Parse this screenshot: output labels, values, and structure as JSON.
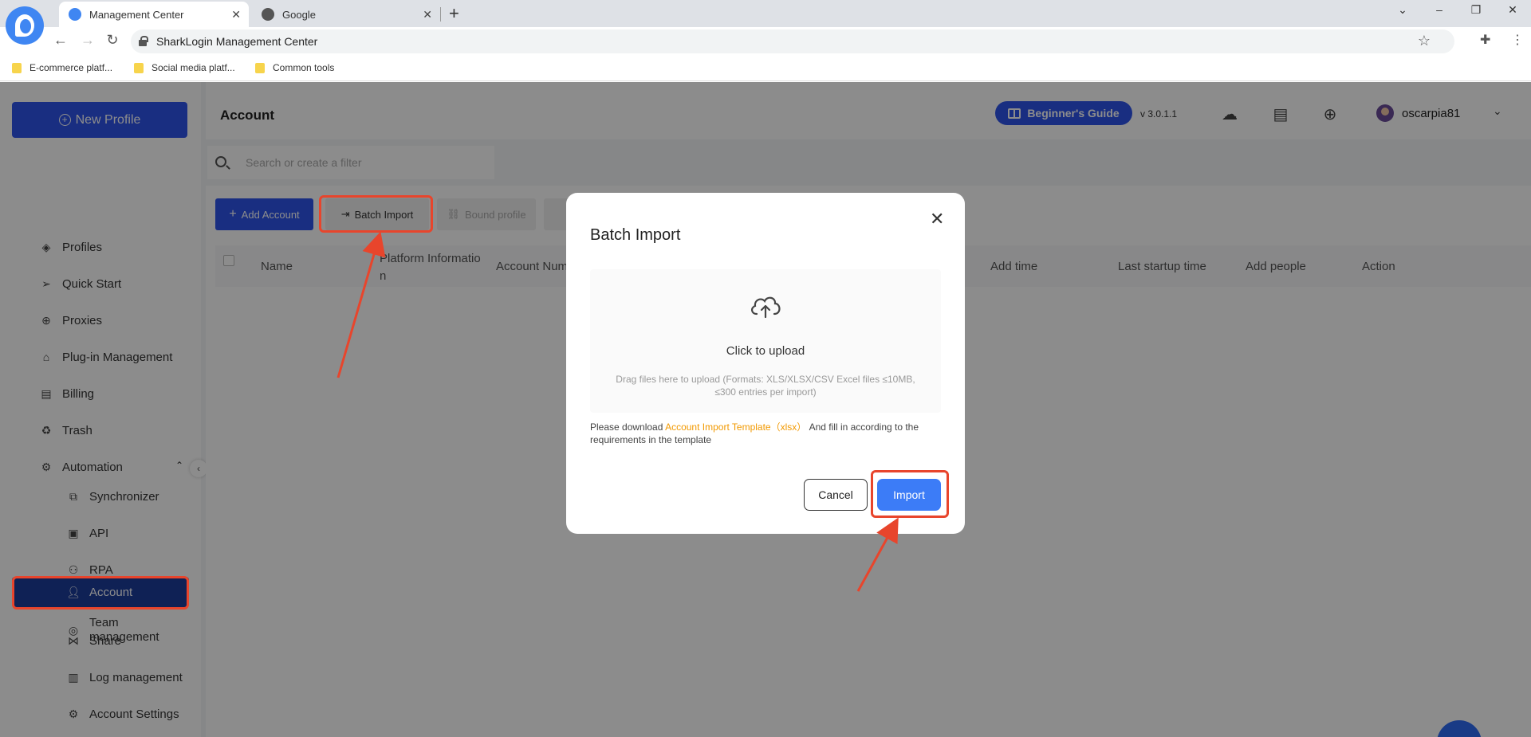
{
  "browser": {
    "tabs": [
      {
        "title": "Management Center",
        "active": true
      },
      {
        "title": "Google",
        "active": false
      }
    ],
    "url": "SharkLogin Management Center",
    "bookmarks": [
      "E-commerce platf...",
      "Social media platf...",
      "Common tools"
    ]
  },
  "sidebar": {
    "new_profile": "New Profile",
    "items": {
      "profiles": "Profiles",
      "quick_start": "Quick Start",
      "proxies": "Proxies",
      "plugin": "Plug-in Management",
      "billing": "Billing",
      "trash": "Trash",
      "automation": "Automation",
      "synchronizer": "Synchronizer",
      "api": "API",
      "rpa": "RPA",
      "team": "Team",
      "team_management_1": "Team",
      "team_management_2": "management",
      "account": "Account",
      "share": "Share",
      "log_management": "Log management",
      "account_settings": "Account Settings"
    }
  },
  "header": {
    "title": "Account",
    "guide": "Beginner's Guide",
    "version": "v 3.0.1.1",
    "username": "oscarpia81"
  },
  "search": {
    "placeholder": "Search or create a filter"
  },
  "toolbar": {
    "add_account": "Add Account",
    "batch_import": "Batch Import",
    "bound_profile": "Bound profile"
  },
  "table": {
    "columns": {
      "name": "Name",
      "platform_1": "Platform Informatio",
      "platform_2": "n",
      "account_num": "Account Num",
      "add_time": "Add time",
      "last_startup": "Last startup time",
      "add_people": "Add people",
      "action": "Action"
    }
  },
  "modal": {
    "title": "Batch Import",
    "upload_title": "Click to upload",
    "upload_hint": "Drag files here to upload (Formats: XLS/XLSX/CSV Excel files ≤10MB, ≤300 entries per import)",
    "note_prefix": "Please download",
    "template_link": "Account Import Template（xlsx）",
    "note_suffix": "And fill in according to the requirements in the template",
    "cancel": "Cancel",
    "import": "Import"
  },
  "colors": {
    "primary": "#2f54eb",
    "import_button": "#3c7cf7",
    "annotation": "#e8452c",
    "link": "#f29900"
  }
}
